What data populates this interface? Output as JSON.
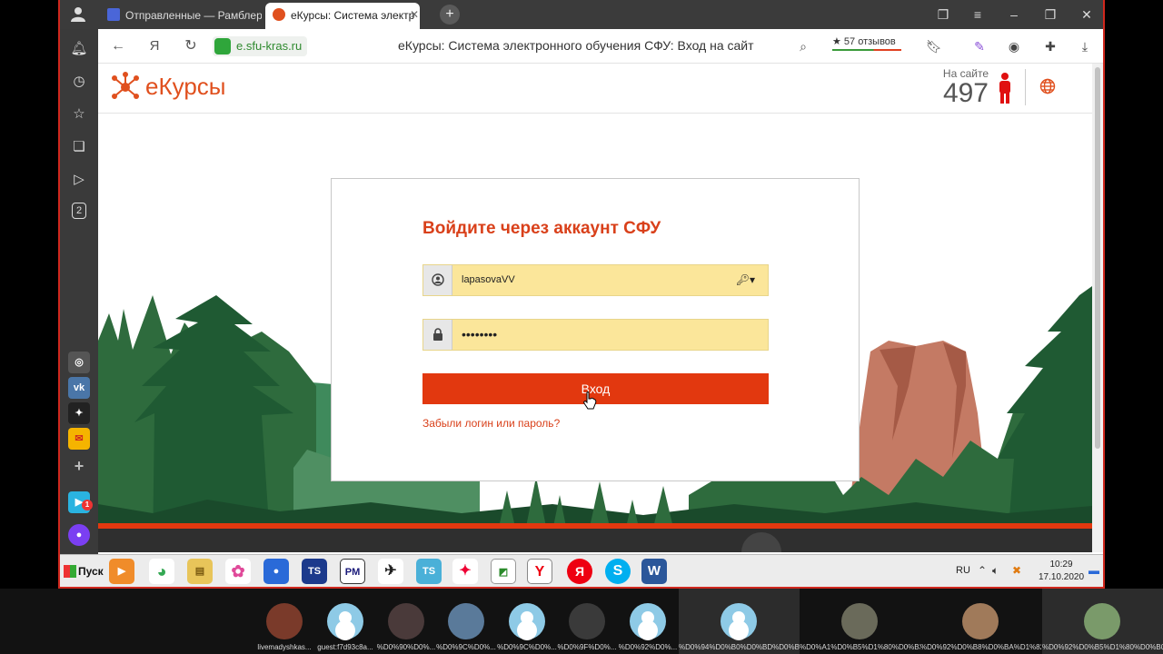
{
  "browser": {
    "tabs": [
      {
        "label": "Отправленные — Рамблер",
        "active": false
      },
      {
        "label": "еКурсы: Система электр",
        "active": true
      }
    ],
    "new_tab_label": "+",
    "url": "e.sfu-kras.ru",
    "page_title": "еКурсы: Система электронного обучения СФУ: Вход на сайт",
    "reviews_label": "★ 57 отзывов",
    "sidebar_badge": "2"
  },
  "site": {
    "logo_text": "еКурсы",
    "online_label": "На сайте",
    "online_count": "497",
    "colors": {
      "accent": "#e2380f",
      "brand": "#e0501e"
    }
  },
  "login": {
    "title": "Войдите через аккаунт СФУ",
    "username_value": "lapasovaVV",
    "password_value": "••••••••",
    "submit_label": "Вход",
    "forgot_link": "Забыли логин или пароль?"
  },
  "taskbar": {
    "start_label": "Пуск",
    "lang": "RU",
    "time": "10:29",
    "date": "17.10.2020",
    "notification_badge": "1"
  },
  "participants": [
    {
      "name": "livemadyshkas...",
      "avatar": "photo"
    },
    {
      "name": "guest:f7d93c8a...",
      "avatar": "default"
    },
    {
      "name": "%D0%90%D0%...",
      "avatar": "photo"
    },
    {
      "name": "%D0%9C%D0%...",
      "avatar": "photo"
    },
    {
      "name": "%D0%9C%D0%...",
      "avatar": "default"
    },
    {
      "name": "%D0%9F%D0%...",
      "avatar": "photo"
    },
    {
      "name": "%D0%92%D0%...",
      "avatar": "default"
    },
    {
      "name": "%D0%94%D0%B0%D0%BD%D0%B8...",
      "avatar": "default"
    },
    {
      "name": "%D0%A1%D0%B5%D1%80%D0%B3%D0%B5%D0%B9",
      "avatar": "photo"
    },
    {
      "name": "%D0%92%D0%B8%D0%BA%D1%82...",
      "avatar": "photo"
    },
    {
      "name": "%D0%92%D0%B5%D1%80%D0%B0...",
      "avatar": "photo"
    }
  ]
}
